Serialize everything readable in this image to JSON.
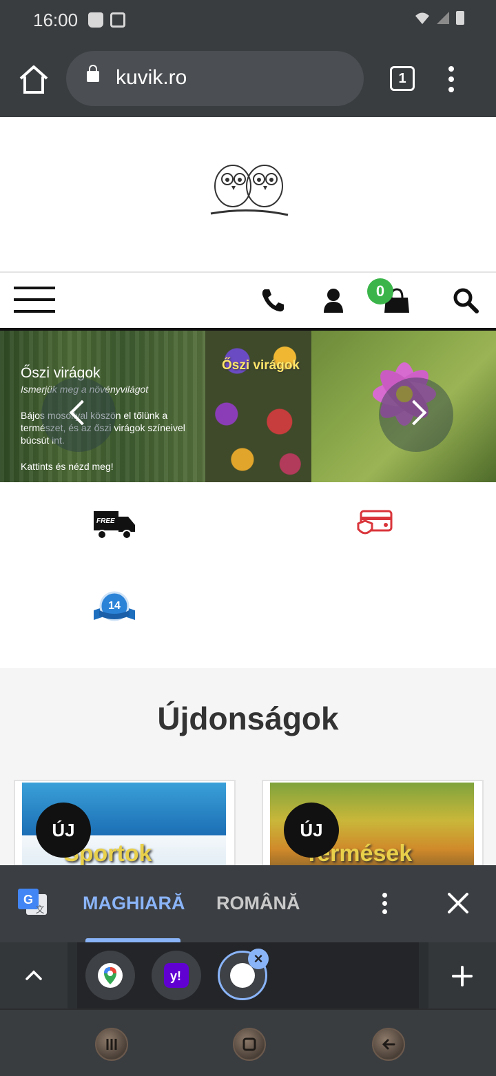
{
  "status_bar": {
    "time": "16:00"
  },
  "browser": {
    "url": "kuvik.ro",
    "tab_count": "1"
  },
  "cart": {
    "count": "0"
  },
  "slider": {
    "slide_title": "Őszi virágok",
    "slide_subtitle": "Ismerjük meg a növényvilágot",
    "slide_body": "Bájos mosollyal köszön el tőlünk a természet, és az őszi virágok színeivel búcsút int.",
    "slide_cta": "Kattints és nézd meg!",
    "middle_title": "Őszi virágok"
  },
  "features": {
    "free_label": "FREE",
    "days_badge": "14"
  },
  "new_products": {
    "title": "Újdonságok",
    "badge": "ÚJ",
    "items": [
      {
        "label": "Sportok"
      },
      {
        "label": "Termések"
      }
    ]
  },
  "translate": {
    "lang_source": "MAGHIARĂ",
    "lang_target": "ROMÂNĂ"
  },
  "colors": {
    "accent": "#8ab4f8",
    "cart_badge": "#3bb54a",
    "chrome_bg": "#3a3d40"
  }
}
